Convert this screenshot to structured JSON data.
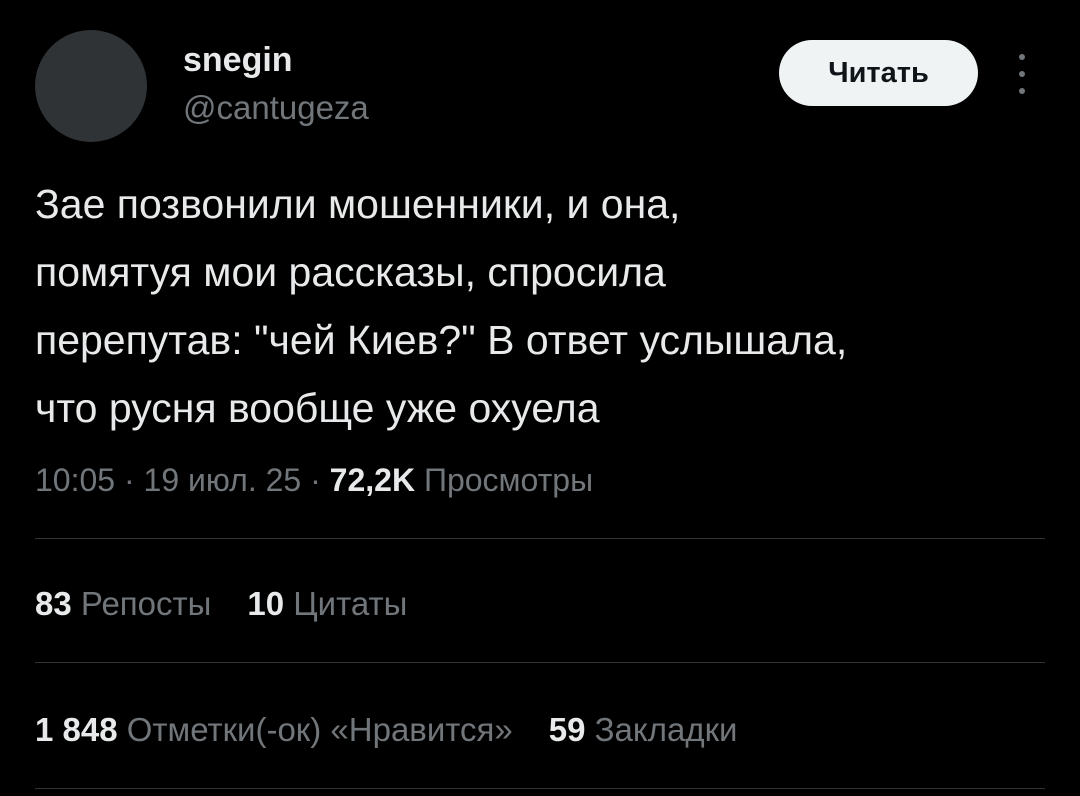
{
  "author": {
    "display_name": "snegin",
    "handle": "@cantugeza"
  },
  "follow_button": {
    "label": "Читать"
  },
  "icons": {
    "more": "more-vertical-icon"
  },
  "tweet": {
    "text": "Зае позвонили мошенники, и она,\nпомятуя мои рассказы, спросила\nперепутав: \"чей Киев?\" В ответ услышала,\nчто русня вообще уже охуела",
    "time": "10:05",
    "date": "19 июл. 25",
    "views_count": "72,2K",
    "views_label": "Просмотры"
  },
  "stats": {
    "reposts": {
      "count": "83",
      "label": "Репосты"
    },
    "quotes": {
      "count": "10",
      "label": "Цитаты"
    },
    "likes": {
      "count": "1 848",
      "label": "Отметки(-ок) «Нравится»"
    },
    "bookmarks": {
      "count": "59",
      "label": "Закладки"
    }
  },
  "colors": {
    "background": "#000000",
    "text_primary": "#e7e9ea",
    "text_secondary": "#71767b",
    "divider": "#2f3336",
    "button_bg": "#eff3f4"
  }
}
